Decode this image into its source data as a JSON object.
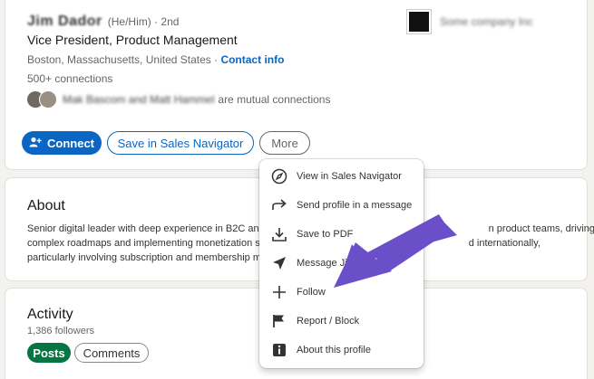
{
  "profile": {
    "name": "Jim Dador",
    "pronouns": "(He/Him) · 2nd",
    "headline": "Vice President, Product Management",
    "location": "Boston, Massachusetts, United States · ",
    "contact_info": "Contact info",
    "connections": "500+ connections",
    "mutual_names": "Mak Bascom and Matt Hammel",
    "mutual_suffix": "are mutual connections",
    "company_name": "Some company Inc"
  },
  "actions": {
    "connect": "Connect",
    "sales_navigator": "Save in Sales Navigator",
    "more": "More"
  },
  "menu": {
    "items": [
      {
        "label": "View in Sales Navigator",
        "icon": "compass-icon"
      },
      {
        "label": "Send profile in a message",
        "icon": "share-arrow-icon"
      },
      {
        "label": "Save to PDF",
        "icon": "download-icon"
      },
      {
        "label": "Message Jim",
        "icon": "send-icon"
      },
      {
        "label": "Follow",
        "icon": "plus-icon"
      },
      {
        "label": "Report / Block",
        "icon": "flag-icon"
      },
      {
        "label": "About this profile",
        "icon": "info-icon"
      }
    ]
  },
  "about": {
    "title": "About",
    "lines": [
      "Senior digital leader with deep experience in B2C and",
      "complex roadmaps and implementing monetization s",
      "particularly involving subscription and membership m"
    ],
    "lines_right": [
      "n product teams, driving",
      "d internationally,"
    ]
  },
  "activity": {
    "title": "Activity",
    "followers": "1,386 followers",
    "posts": "Posts",
    "comments": "Comments"
  },
  "colors": {
    "primary": "#0a66c2",
    "posts_green": "#057642",
    "arrow": "#6a4fc8"
  }
}
